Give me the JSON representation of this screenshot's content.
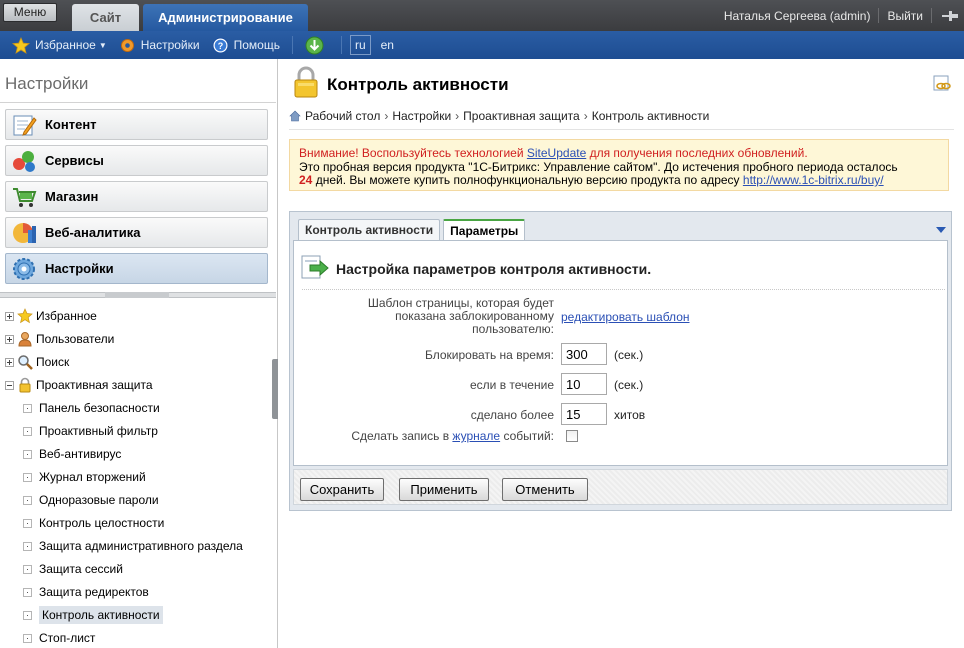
{
  "topbar": {
    "menu_label": "Меню",
    "tab_site": "Сайт",
    "tab_admin": "Администрирование",
    "user_name": "Наталья Сергеева (admin)",
    "logout": "Выйти"
  },
  "toolbar": {
    "favorites": "Избранное",
    "settings": "Настройки",
    "help": "Помощь",
    "lang_ru": "ru",
    "lang_en": "en"
  },
  "left": {
    "title": "Настройки",
    "categories": [
      {
        "label": "Контент",
        "icon": "content-icon"
      },
      {
        "label": "Сервисы",
        "icon": "services-icon"
      },
      {
        "label": "Магазин",
        "icon": "shop-icon"
      },
      {
        "label": "Веб-аналитика",
        "icon": "analytics-icon"
      },
      {
        "label": "Настройки",
        "icon": "settings-icon"
      }
    ],
    "tree": [
      {
        "label": "Избранное",
        "icon": "star-icon"
      },
      {
        "label": "Пользователи",
        "icon": "user-icon"
      },
      {
        "label": "Поиск",
        "icon": "search-icon"
      },
      {
        "label": "Проактивная защита",
        "icon": "lock-icon"
      },
      {
        "label": "Панель безопасности"
      },
      {
        "label": "Проактивный фильтр"
      },
      {
        "label": "Веб-антивирус"
      },
      {
        "label": "Журнал вторжений"
      },
      {
        "label": "Одноразовые пароли"
      },
      {
        "label": "Контроль целостности"
      },
      {
        "label": "Защита административного раздела"
      },
      {
        "label": "Защита сессий"
      },
      {
        "label": "Защита редиректов"
      },
      {
        "label": "Контроль активности"
      },
      {
        "label": "Стоп-лист"
      }
    ]
  },
  "page": {
    "title": "Контроль активности",
    "breadcrumbs": [
      "Рабочий стол",
      "Настройки",
      "Проактивная защита",
      "Контроль активности"
    ]
  },
  "notice": {
    "line1_a": "Внимание! Воспользуйтесь технологией ",
    "line1_link": "SiteUpdate",
    "line1_b": " для получения последних обновлений.",
    "line2": "Это пробная версия продукта \"1С-Битрикс: Управление сайтом\". До истечения пробного периода осталось",
    "days": "24",
    "line3": " дней. Вы можете купить полнофункциональную версию продукта по адресу ",
    "url": "http://www.1c-bitrix.ru/buy/"
  },
  "panel": {
    "tab1": "Контроль активности",
    "tab2": "Параметры",
    "section_title": "Настройка параметров контроля активности.",
    "template_label_1": "Шаблон страницы, которая будет",
    "template_label_2": "показана заблокированному",
    "template_label_3": "пользователю:",
    "template_link": "редактировать шаблон",
    "block_label": "Блокировать на время:",
    "block_value": "300",
    "block_unit": "(сек.)",
    "within_label": "если в течение",
    "within_value": "10",
    "within_unit": "(сек.)",
    "hits_label": "сделано более",
    "hits_value": "15",
    "hits_unit": "хитов",
    "log_label_a": "Сделать запись в ",
    "log_link": "журнале",
    "log_label_b": " событий:",
    "save": "Сохранить",
    "apply": "Применить",
    "cancel": "Отменить"
  }
}
